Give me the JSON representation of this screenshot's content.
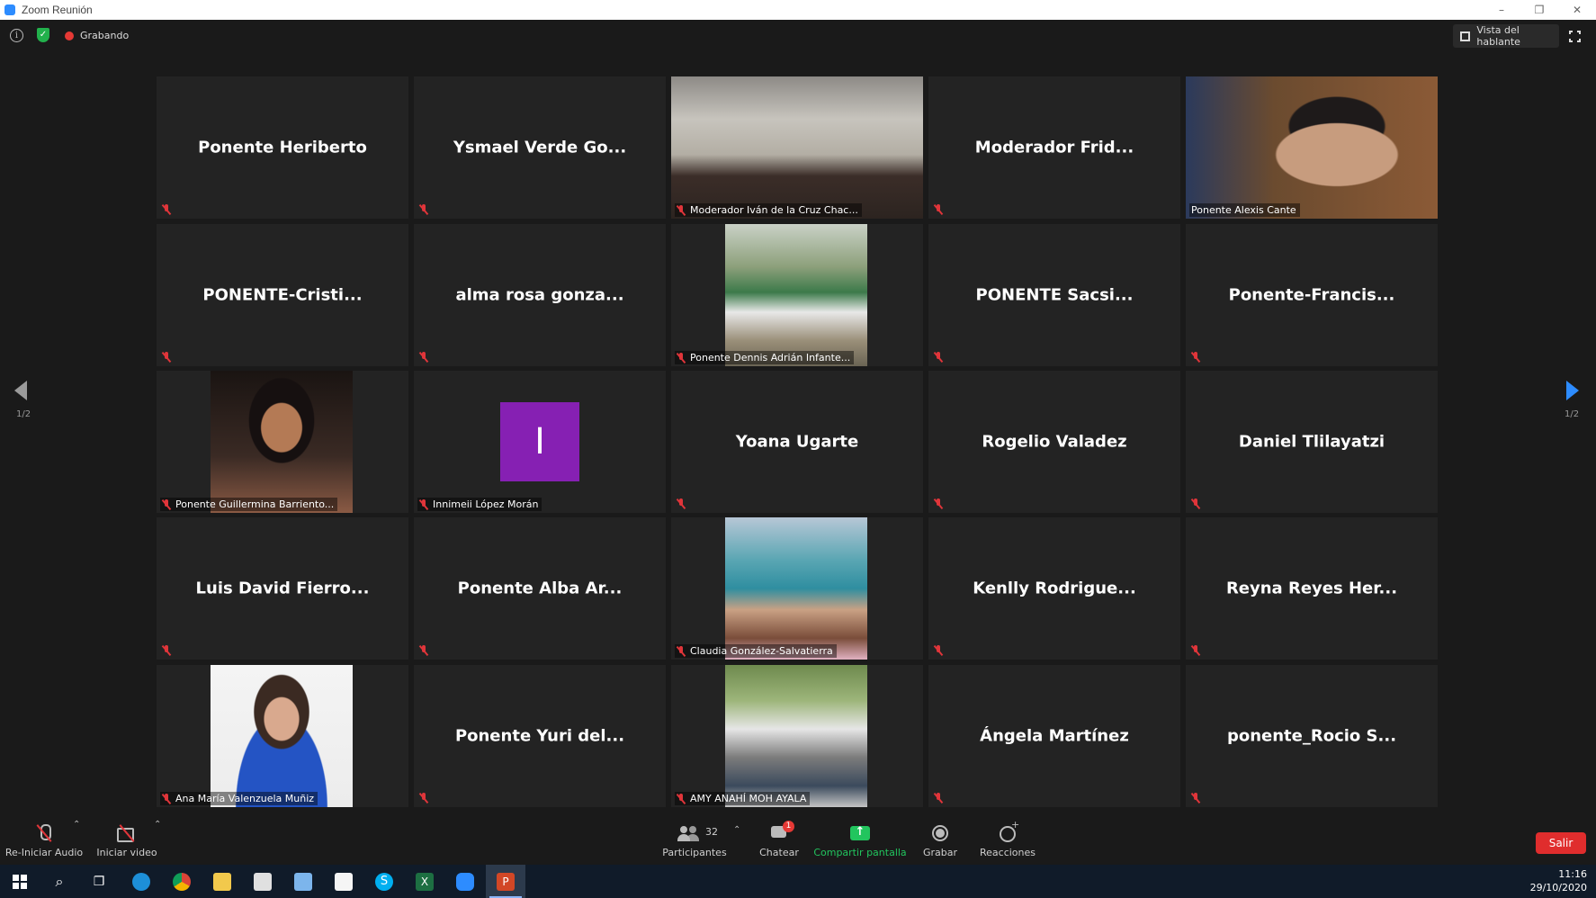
{
  "window": {
    "title": "Zoom Reunión",
    "controls": [
      "–",
      "❐",
      "✕"
    ]
  },
  "topbar": {
    "recording_label": "Grabando",
    "speaker_view_label": "Vista del hablante"
  },
  "pagination": {
    "left": "1/2",
    "right": "1/2"
  },
  "tiles": [
    {
      "name": "Ponente Heriberto",
      "type": "name"
    },
    {
      "name": "Ysmael Verde Go...",
      "type": "name"
    },
    {
      "name": "Moderador Iván de la Cruz Chac...",
      "type": "video",
      "video_class": "v-ivan",
      "active": true
    },
    {
      "name": "Moderador Frid...",
      "type": "name"
    },
    {
      "name": "Ponente Alexis Cante",
      "type": "video",
      "video_class": "v-alexis",
      "muted": false
    },
    {
      "name": "PONENTE-Cristi...",
      "type": "name"
    },
    {
      "name": "alma rosa gonza...",
      "type": "name"
    },
    {
      "name": "Ponente Dennis Adrián Infante...",
      "type": "video",
      "video_class": "v-dennis"
    },
    {
      "name": "PONENTE Sacsi...",
      "type": "name"
    },
    {
      "name": "Ponente-Francis...",
      "type": "name"
    },
    {
      "name": "Ponente Guillermina Barriento...",
      "type": "video",
      "video_class": "v-guillermina"
    },
    {
      "name": "Innimeii López Morán",
      "type": "initial",
      "initial": "I"
    },
    {
      "name": "Yoana Ugarte",
      "type": "name"
    },
    {
      "name": "Rogelio Valadez",
      "type": "name"
    },
    {
      "name": "Daniel Tlilayatzi",
      "type": "name"
    },
    {
      "name": "Luis David Fierro...",
      "type": "name"
    },
    {
      "name": "Ponente Alba Ar...",
      "type": "name"
    },
    {
      "name": "Claudia González-Salvatierra",
      "type": "video",
      "video_class": "v-claudia"
    },
    {
      "name": "Kenlly Rodrigue...",
      "type": "name"
    },
    {
      "name": "Reyna Reyes Her...",
      "type": "name"
    },
    {
      "name": "Ana María Valenzuela Muñiz",
      "type": "video",
      "video_class": "v-ana"
    },
    {
      "name": "Ponente Yuri del...",
      "type": "name"
    },
    {
      "name": "AMY ANAHÍ MOH AYALA",
      "type": "video",
      "video_class": "v-amy"
    },
    {
      "name": "Ángela Martínez",
      "type": "name"
    },
    {
      "name": "ponente_Rocio S...",
      "type": "name"
    }
  ],
  "toolbar": {
    "audio_label": "Re-Iniciar Audio",
    "video_label": "Iniciar video",
    "participants_label": "Participantes",
    "participants_count": "32",
    "chat_label": "Chatear",
    "chat_badge": "1",
    "share_label": "Compartir pantalla",
    "record_label": "Grabar",
    "reactions_label": "Reacciones",
    "leave_label": "Salir"
  },
  "taskbar": {
    "apps": [
      "start",
      "search",
      "task-view",
      "edge",
      "chrome",
      "file-explorer",
      "store",
      "sticky",
      "mail",
      "skype",
      "excel",
      "zoom",
      "powerpoint"
    ],
    "time": "11:16",
    "date": "29/10/2020"
  },
  "colors": {
    "active_speaker_outline": "#d7ec5a",
    "share_green": "#22c55e",
    "leave_red": "#e02d2d",
    "page_arrow_active": "#2d8cff",
    "initial_tile": "#8620b3"
  }
}
